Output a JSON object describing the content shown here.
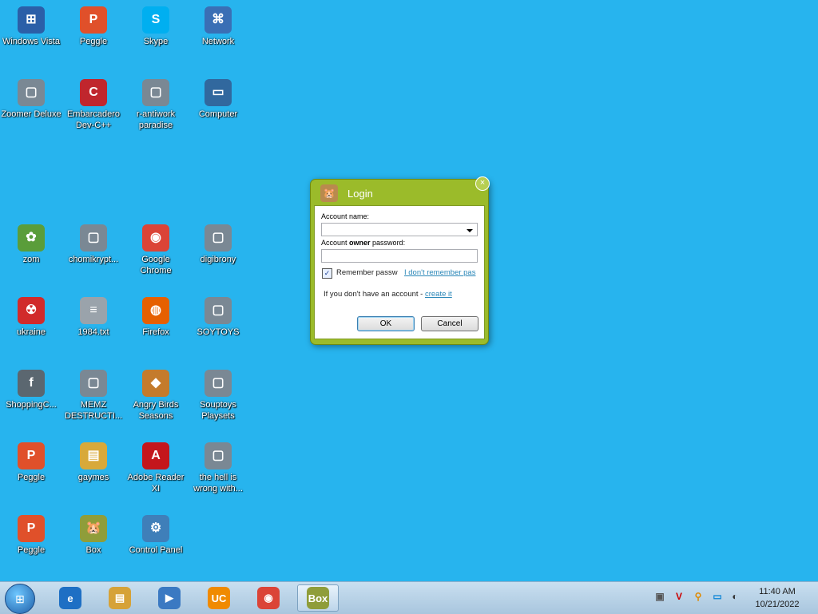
{
  "colors": {
    "desktop_background": "#27b4ee",
    "dialog_frame": "#9bbb2a",
    "taskbar": "#bcd5ea",
    "link": "#2a87b8"
  },
  "desktop": {
    "icons": [
      {
        "label": "Windows Vista",
        "icon": "orb-icon"
      },
      {
        "label": "Peggle",
        "icon": "peggle-icon"
      },
      {
        "label": "Skype",
        "icon": "skype-icon"
      },
      {
        "label": "Network",
        "icon": "network-icon"
      },
      {
        "label": "Zoomer Deluxe",
        "icon": "app-icon"
      },
      {
        "label": "Embarcadero Dev-C++",
        "icon": "devcpp-icon"
      },
      {
        "label": "r-antiwork paradise",
        "icon": "app-icon"
      },
      {
        "label": "Computer",
        "icon": "computer-icon"
      },
      {
        "label": "zom",
        "icon": "flower-icon"
      },
      {
        "label": "chomikrypt...",
        "icon": "app-icon"
      },
      {
        "label": "Google Chrome",
        "icon": "chrome-icon"
      },
      {
        "label": "digibrony",
        "icon": "app-icon"
      },
      {
        "label": "ukraine",
        "icon": "radiation-icon"
      },
      {
        "label": "1984.txt",
        "icon": "text-file-icon"
      },
      {
        "label": "Firefox",
        "icon": "firefox-icon"
      },
      {
        "label": "SOYTOYS",
        "icon": "app-icon"
      },
      {
        "label": "ShoppingC...",
        "icon": "flash-icon"
      },
      {
        "label": "MEMZ DESTRUCTI...",
        "icon": "app-icon"
      },
      {
        "label": "Angry Birds Seasons",
        "icon": "game-icon"
      },
      {
        "label": "Souptoys Playsets",
        "icon": "app-icon"
      },
      {
        "label": "Peggle",
        "icon": "peggle-icon"
      },
      {
        "label": "gaymes",
        "icon": "folder-icon"
      },
      {
        "label": "Adobe Reader XI",
        "icon": "pdf-icon"
      },
      {
        "label": "the hell is wrong with...",
        "icon": "app-icon"
      },
      {
        "label": "Peggle",
        "icon": "peggle-icon"
      },
      {
        "label": "Box",
        "icon": "hamster-icon"
      },
      {
        "label": "Control Panel",
        "icon": "control-panel-icon"
      }
    ]
  },
  "login_dialog": {
    "title": "Login",
    "close_glyph": "×",
    "account_name_label": "Account name:",
    "account_name_value": "",
    "password_label_prefix": "Account ",
    "password_label_bold": "owner",
    "password_label_suffix": " password:",
    "password_value": "",
    "remember_label": "Remember passw",
    "remember_checked": true,
    "forgot_link": "I don't remember pas",
    "no_account_text": "If you don't have an account - ",
    "create_link": "create it",
    "ok_label": "OK",
    "cancel_label": "Cancel"
  },
  "taskbar": {
    "pinned": [
      {
        "name": "internet-explorer",
        "glyph": "e"
      },
      {
        "name": "file-explorer",
        "glyph": "▤"
      },
      {
        "name": "media-player",
        "glyph": "▶"
      },
      {
        "name": "uc-browser",
        "glyph": "UC"
      },
      {
        "name": "chrome",
        "glyph": "◉"
      },
      {
        "name": "box-app",
        "glyph": "Box"
      }
    ],
    "clock_time": "11:40 AM",
    "clock_date": "10/21/2022"
  }
}
